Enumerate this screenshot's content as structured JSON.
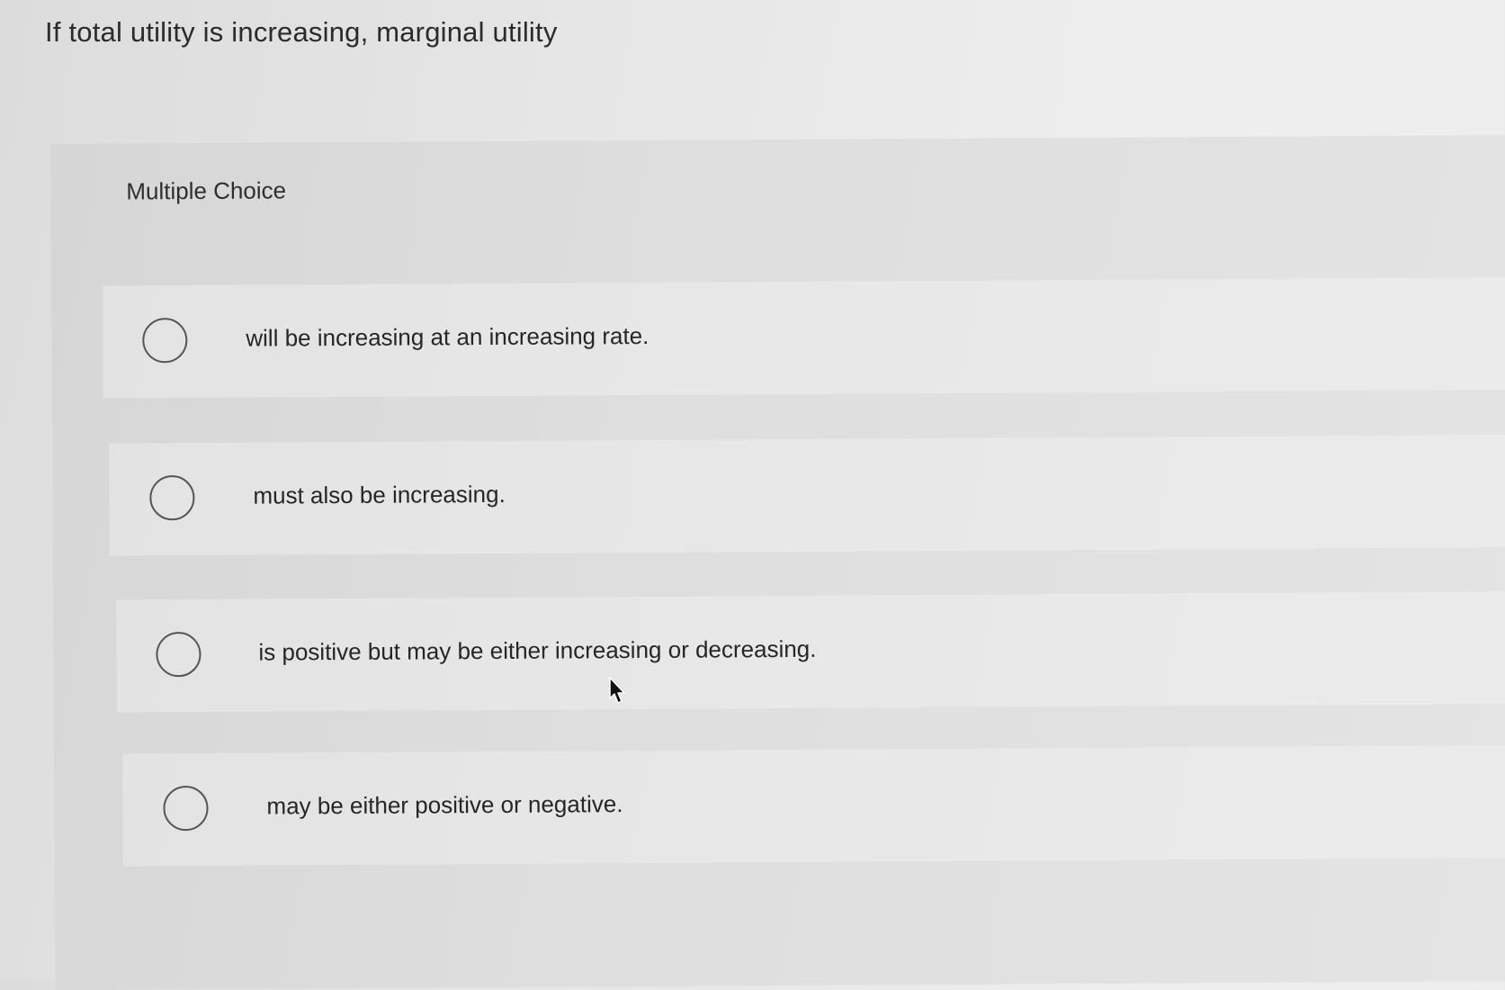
{
  "question": {
    "text": "If total utility is increasing, marginal utility"
  },
  "panel": {
    "label": "Multiple Choice"
  },
  "options": [
    {
      "text": "will be increasing at an increasing rate.",
      "selected": false
    },
    {
      "text": "must also be increasing.",
      "selected": false
    },
    {
      "text": "is positive but may be either increasing or decreasing.",
      "selected": false
    },
    {
      "text": "may be either positive or negative.",
      "selected": false
    }
  ],
  "icons": {
    "radio": "radio-button-icon",
    "cursor": "mouse-pointer-icon"
  },
  "colors": {
    "text": "#2a2a2a",
    "radio_border": "#555555"
  }
}
